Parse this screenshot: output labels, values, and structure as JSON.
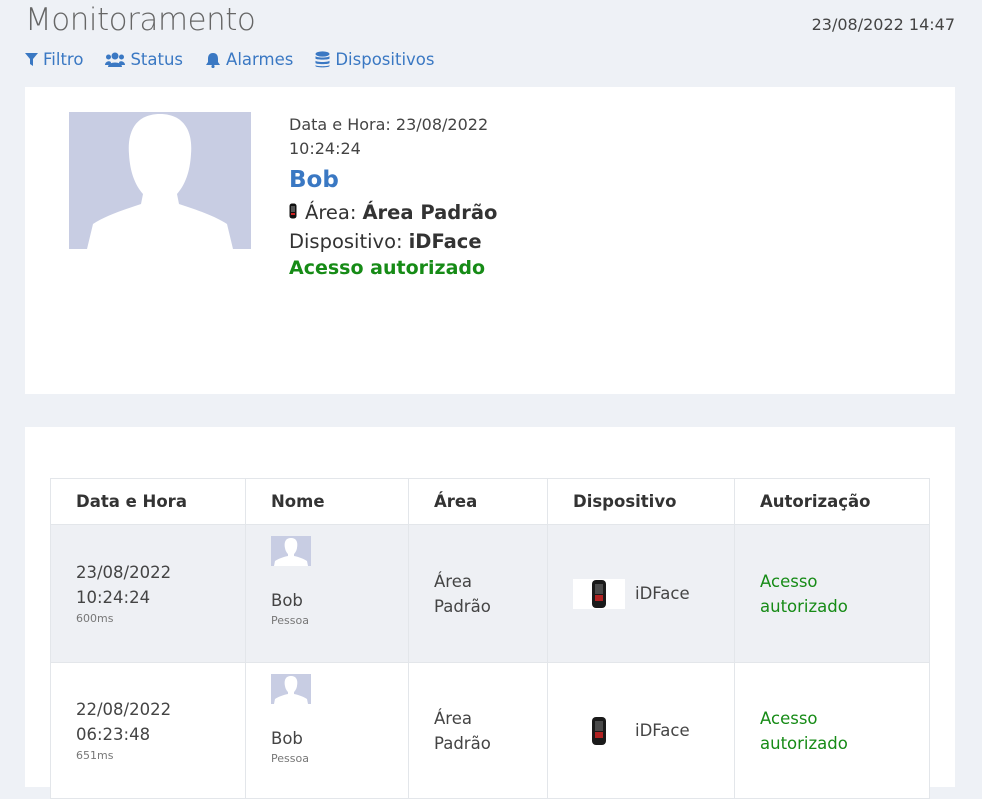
{
  "header": {
    "title": "Monitoramento",
    "datetime": "23/08/2022 14:47"
  },
  "nav": [
    {
      "label": "Filtro",
      "icon": "filter-icon"
    },
    {
      "label": "Status",
      "icon": "users-icon"
    },
    {
      "label": "Alarmes",
      "icon": "bell-icon"
    },
    {
      "label": "Dispositivos",
      "icon": "database-icon"
    }
  ],
  "latest": {
    "datetime_label": "Data e Hora: 23/08/2022",
    "time": "10:24:24",
    "name": "Bob",
    "area_label": "Área:",
    "area_value": "Área Padrão",
    "device_label": "Dispositivo:",
    "device_value": "iDFace",
    "status": "Acesso autorizado"
  },
  "table": {
    "headers": [
      "Data e Hora",
      "Nome",
      "Área",
      "Dispositivo",
      "Autorização"
    ],
    "rows": [
      {
        "date": "23/08/2022",
        "time": "10:24:24",
        "ms": "600ms",
        "name": "Bob",
        "type": "Pessoa",
        "area1": "Área",
        "area2": "Padrão",
        "device": "iDFace",
        "auth1": "Acesso",
        "auth2": "autorizado"
      },
      {
        "date": "22/08/2022",
        "time": "06:23:48",
        "ms": "651ms",
        "name": "Bob",
        "type": "Pessoa",
        "area1": "Área",
        "area2": "Padrão",
        "device": "iDFace",
        "auth1": "Acesso",
        "auth2": "autorizado"
      }
    ]
  },
  "colors": {
    "accent": "#3a78c3",
    "success": "#168b16",
    "background": "#eef1f6",
    "avatar": "#c8cde3"
  }
}
